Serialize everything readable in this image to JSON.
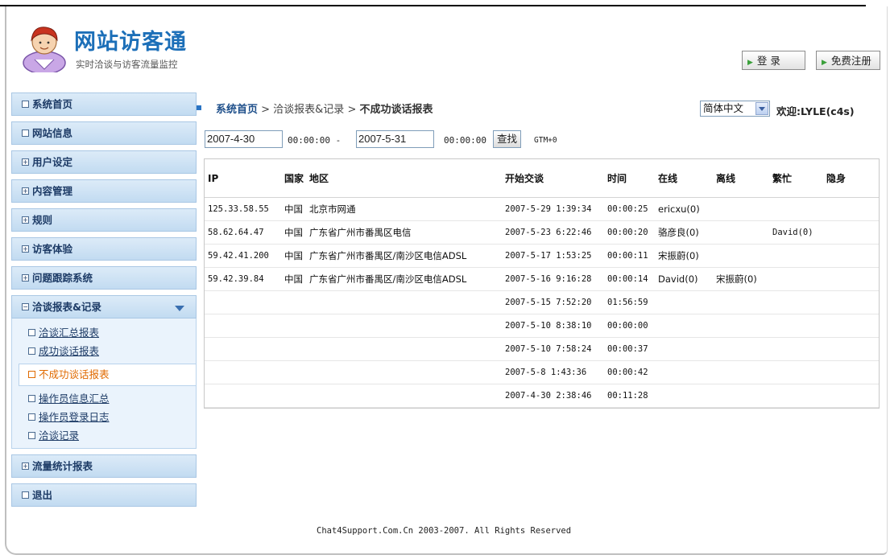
{
  "header": {
    "title": "网站访客通",
    "subtitle": "实时洽谈与访客流量监控",
    "login_label": "登 录",
    "register_label": "免费注册"
  },
  "sidebar": {
    "items": [
      {
        "label": "系统首页",
        "icon": "square"
      },
      {
        "label": "网站信息",
        "icon": "square"
      },
      {
        "label": "用户设定",
        "icon": "plus"
      },
      {
        "label": "内容管理",
        "icon": "plus"
      },
      {
        "label": "规则",
        "icon": "plus"
      },
      {
        "label": "访客体验",
        "icon": "plus"
      },
      {
        "label": "问题跟踪系统",
        "icon": "plus"
      },
      {
        "label": "洽谈报表&记录",
        "icon": "minus",
        "expanded": true
      }
    ],
    "subitems": [
      {
        "label": "洽谈汇总报表"
      },
      {
        "label": "成功谈话报表"
      },
      {
        "label": "不成功谈话报表",
        "active": true
      },
      {
        "label": "操作员信息汇总"
      },
      {
        "label": "操作员登录日志"
      },
      {
        "label": "洽谈记录"
      }
    ],
    "bottom_items": [
      {
        "label": "流量统计报表",
        "icon": "plus"
      },
      {
        "label": "退出",
        "icon": "square"
      }
    ]
  },
  "breadcrumb": {
    "home": "系统首页",
    "section": " > 洽谈报表&记录 > ",
    "current": "不成功谈话报表"
  },
  "language": {
    "selected": "简体中文"
  },
  "welcome": "欢迎:LYLE(c4s)",
  "filter": {
    "start_date": "2007-4-30",
    "start_time": "00:00:00 -",
    "end_date": "2007-5-31",
    "end_time": "00:00:00",
    "find_label": "查找",
    "timezone": "GTM+0"
  },
  "table": {
    "headers": [
      "IP",
      "国家",
      "地区",
      "开始交谈",
      "时间",
      "在线",
      "离线",
      "繁忙",
      "隐身"
    ],
    "rows": [
      [
        "125.33.58.55",
        "中国",
        "北京市网通",
        "2007-5-29 1:39:34",
        "00:00:25",
        "ericxu(0)",
        "",
        "",
        ""
      ],
      [
        "58.62.64.47",
        "中国",
        "广东省广州市番禺区电信",
        "2007-5-23 6:22:46",
        "00:00:20",
        "骆彦良(0)",
        "",
        "David(0)",
        ""
      ],
      [
        "59.42.41.200",
        "中国",
        "广东省广州市番禺区/南沙区电信ADSL",
        "2007-5-17 1:53:25",
        "00:00:11",
        "宋振蔚(0)",
        "",
        "",
        ""
      ],
      [
        "59.42.39.84",
        "中国",
        "广东省广州市番禺区/南沙区电信ADSL",
        "2007-5-16 9:16:28",
        "00:00:14",
        "David(0)",
        "宋振蔚(0)",
        "",
        ""
      ],
      [
        "",
        "",
        "",
        "2007-5-15 7:52:20",
        "01:56:59",
        "",
        "",
        "",
        ""
      ],
      [
        "",
        "",
        "",
        "2007-5-10 8:38:10",
        "00:00:00",
        "",
        "",
        "",
        ""
      ],
      [
        "",
        "",
        "",
        "2007-5-10 7:58:24",
        "00:00:37",
        "",
        "",
        "",
        ""
      ],
      [
        "",
        "",
        "",
        "2007-5-8 1:43:36",
        "00:00:42",
        "",
        "",
        "",
        ""
      ],
      [
        "",
        "",
        "",
        "2007-4-30 2:38:46",
        "00:11:28",
        "",
        "",
        "",
        ""
      ]
    ]
  },
  "footer": "Chat4Support.Com.Cn 2003-2007. All Rights Reserved",
  "colors": {
    "brand": "#1c6fb8",
    "nav_bg": "#c2dbf1",
    "active_sub": "#e06a00"
  }
}
